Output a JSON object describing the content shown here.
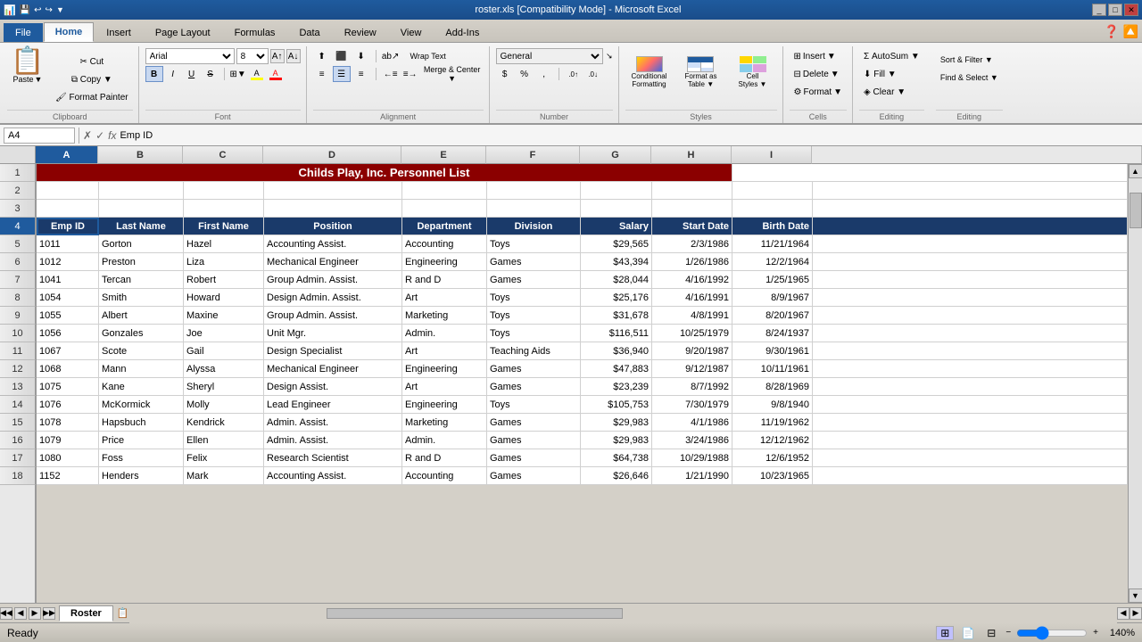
{
  "window": {
    "title": "roster.xls [Compatibility Mode] - Microsoft Excel",
    "icon": "📊"
  },
  "quick_access": {
    "buttons": [
      "💾",
      "↩",
      "↪",
      "▼"
    ]
  },
  "tabs": {
    "items": [
      "File",
      "Home",
      "Insert",
      "Page Layout",
      "Formulas",
      "Data",
      "Review",
      "View",
      "Add-Ins"
    ],
    "active": "Home"
  },
  "ribbon": {
    "clipboard": {
      "label": "Clipboard",
      "paste": "Paste",
      "cut": "✂",
      "copy": "⧉",
      "format_painter": "🖌"
    },
    "font": {
      "label": "Font",
      "family": "Arial",
      "size": "8",
      "bold": "B",
      "italic": "I",
      "underline": "U",
      "strikethrough": "S̶",
      "borders": "⊞",
      "fill_color": "A",
      "font_color": "A"
    },
    "alignment": {
      "label": "Alignment",
      "wrap_text": "Wrap Text",
      "merge": "Merge & Center",
      "align_top": "⊤",
      "align_mid": "≡",
      "align_bot": "⊥",
      "align_left": "≡",
      "align_center": "☰",
      "align_right": "≡",
      "decrease_indent": "←≡",
      "increase_indent": "≡→",
      "orientation": "⟳",
      "more": "↘"
    },
    "number": {
      "label": "Number",
      "format": "General",
      "currency": "$",
      "percent": "%",
      "comma": ",",
      "inc_decimal": ".0",
      "dec_decimal": ".0"
    },
    "styles": {
      "label": "Styles",
      "conditional": "Conditional\nFormatting",
      "format_table": "Format as\nTable",
      "cell_styles": "Cell\nStyles"
    },
    "cells": {
      "label": "Cells",
      "insert": "Insert",
      "delete": "Delete",
      "format": "Format"
    },
    "editing": {
      "label": "Editing",
      "sum": "Σ",
      "fill": "Fill ▼",
      "clear": "Clear ▼",
      "sort_filter": "Sort &\nFilter ▼",
      "find_select": "Find &\nSelect ▼"
    }
  },
  "formula_bar": {
    "name_box": "A4",
    "formula": "Emp ID"
  },
  "columns": {
    "headers": [
      "A",
      "B",
      "C",
      "D",
      "E",
      "F",
      "G",
      "H",
      "I"
    ],
    "selected": "A"
  },
  "spreadsheet": {
    "title": "Childs Play, Inc. Personnel List",
    "headers": [
      "Emp ID",
      "Last Name",
      "First Name",
      "Position",
      "Department",
      "Division",
      "Salary",
      "Start Date",
      "Birth Date"
    ],
    "rows": [
      [
        "1011",
        "Gorton",
        "Hazel",
        "Accounting Assist.",
        "Accounting",
        "Toys",
        "$29,565",
        "2/3/1986",
        "11/21/1964"
      ],
      [
        "1012",
        "Preston",
        "Liza",
        "Mechanical Engineer",
        "Engineering",
        "Games",
        "$43,394",
        "1/26/1986",
        "12/2/1964"
      ],
      [
        "1041",
        "Tercan",
        "Robert",
        "Group Admin. Assist.",
        "R and D",
        "Games",
        "$28,044",
        "4/16/1992",
        "1/25/1965"
      ],
      [
        "1054",
        "Smith",
        "Howard",
        "Design Admin. Assist.",
        "Art",
        "Toys",
        "$25,176",
        "4/16/1991",
        "8/9/1967"
      ],
      [
        "1055",
        "Albert",
        "Maxine",
        "Group Admin. Assist.",
        "Marketing",
        "Toys",
        "$31,678",
        "4/8/1991",
        "8/20/1967"
      ],
      [
        "1056",
        "Gonzales",
        "Joe",
        "Unit Mgr.",
        "Admin.",
        "Toys",
        "$116,511",
        "10/25/1979",
        "8/24/1937"
      ],
      [
        "1067",
        "Scote",
        "Gail",
        "Design Specialist",
        "Art",
        "Teaching Aids",
        "$36,940",
        "9/20/1987",
        "9/30/1961"
      ],
      [
        "1068",
        "Mann",
        "Alyssa",
        "Mechanical Engineer",
        "Engineering",
        "Games",
        "$47,883",
        "9/12/1987",
        "10/11/1961"
      ],
      [
        "1075",
        "Kane",
        "Sheryl",
        "Design Assist.",
        "Art",
        "Games",
        "$23,239",
        "8/7/1992",
        "8/28/1969"
      ],
      [
        "1076",
        "McKormick",
        "Molly",
        "Lead Engineer",
        "Engineering",
        "Toys",
        "$105,753",
        "7/30/1979",
        "9/8/1940"
      ],
      [
        "1078",
        "Hapsbuch",
        "Kendrick",
        "Admin. Assist.",
        "Marketing",
        "Games",
        "$29,983",
        "4/1/1986",
        "11/19/1962"
      ],
      [
        "1079",
        "Price",
        "Ellen",
        "Admin. Assist.",
        "Admin.",
        "Games",
        "$29,983",
        "3/24/1986",
        "12/12/1962"
      ],
      [
        "1080",
        "Foss",
        "Felix",
        "Research Scientist",
        "R and D",
        "Games",
        "$64,738",
        "10/29/1988",
        "12/6/1952"
      ],
      [
        "1152",
        "Henders",
        "Mark",
        "Accounting Assist.",
        "Accounting",
        "Games",
        "$26,646",
        "1/21/1990",
        "10/23/1965"
      ]
    ]
  },
  "sheet_tabs": [
    "Roster"
  ],
  "status": {
    "ready": "Ready",
    "zoom": "140%",
    "zoom_value": 140
  }
}
